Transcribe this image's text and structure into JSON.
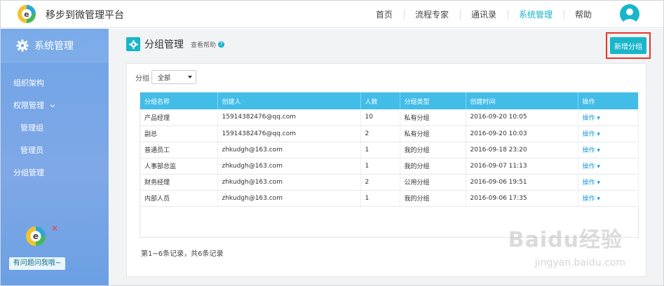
{
  "header": {
    "app_title": "移步到微管理平台",
    "nav": [
      "首页",
      "流程专家",
      "通讯录",
      "系统管理",
      "帮助"
    ],
    "active_nav": "系统管理"
  },
  "sidebar": {
    "title": "系统管理",
    "items": [
      {
        "label": "组织架构"
      },
      {
        "label": "权限管理"
      },
      {
        "label": "管理组"
      },
      {
        "label": "管理员"
      },
      {
        "label": "分组管理"
      }
    ],
    "help_text": "有问题问我哦~"
  },
  "main": {
    "page_title": "分组管理",
    "help_link": "查看帮助",
    "add_button": "新增分组",
    "filter_label": "分组",
    "filter_value": "全部",
    "table": {
      "columns": [
        "分组名称",
        "创建人",
        "人数",
        "分组类型",
        "创建时间",
        "操作"
      ],
      "rows": [
        [
          "产品经理",
          "15914382476@qq.com",
          "10",
          "私有分组",
          "2016-09-20 10:05",
          "操作"
        ],
        [
          "副总",
          "15914382476@qq.com",
          "2",
          "私有分组",
          "2016-09-20 10:03",
          "操作"
        ],
        [
          "普通员工",
          "zhkudgh@163.com",
          "1",
          "我的分组",
          "2016-09-18 23:20",
          "操作"
        ],
        [
          "人事部总监",
          "zhkudgh@163.com",
          "1",
          "我的分组",
          "2016-09-07 11:13",
          "操作"
        ],
        [
          "财务经理",
          "zhkudgh@163.com",
          "2",
          "公用分组",
          "2016-09-06 19:51",
          "操作"
        ],
        [
          "内部人员",
          "zhkudgh@163.com",
          "1",
          "我的分组",
          "2016-09-06 17:35",
          "操作"
        ]
      ]
    },
    "records": "第1~6条记录，共6条记录"
  },
  "watermark": {
    "line1": "Baidu经验",
    "line2": "jingyan.baidu.com"
  },
  "colors": {
    "accent": "#19b6c9",
    "table_header": "#41bde8",
    "highlight_border": "#e8342c"
  }
}
